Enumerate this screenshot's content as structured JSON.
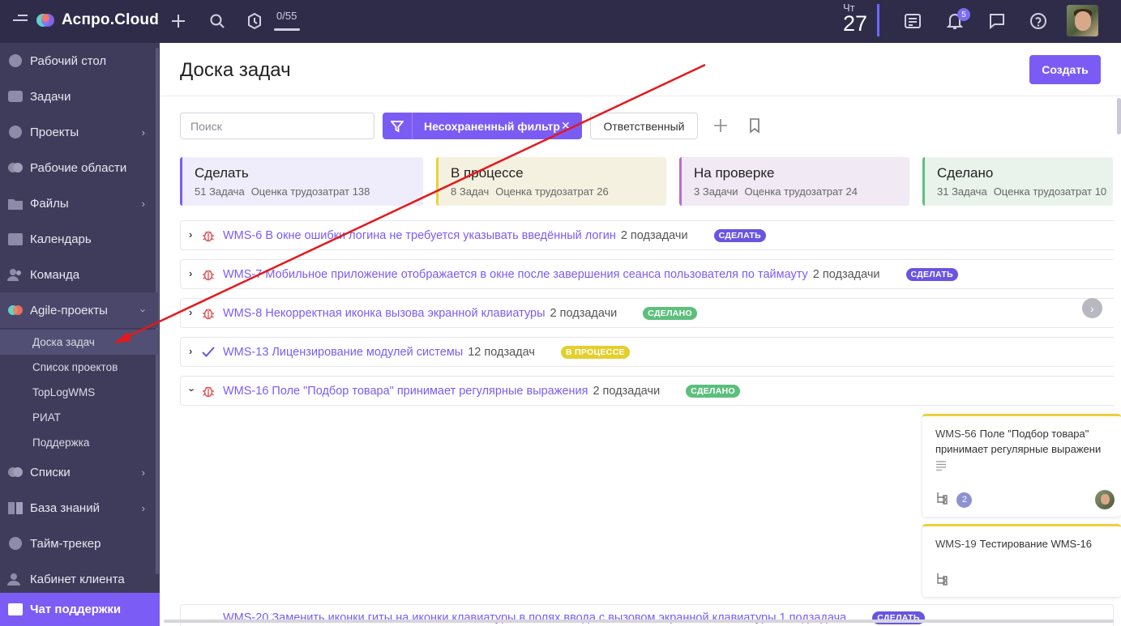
{
  "app": {
    "logo_text": "Аспро.Cloud",
    "progress_counter": "0/55",
    "progress_fraction": 0.0,
    "date_dow": "Чт",
    "date_day": "27",
    "notifications_count": "5",
    "colors": {
      "topbar": "#2f2c4a",
      "sidebar": "#3f3c5b",
      "accent": "#7a5cf4"
    }
  },
  "sidebar": {
    "items": [
      {
        "label": "Рабочий стол",
        "icon": "desktop-icon"
      },
      {
        "label": "Задачи",
        "icon": "tasks-icon"
      },
      {
        "label": "Проекты",
        "icon": "projects-icon"
      },
      {
        "label": "Рабочие области",
        "icon": "workspaces-icon"
      },
      {
        "label": "Файлы",
        "icon": "files-icon"
      },
      {
        "label": "Календарь",
        "icon": "calendar-icon"
      },
      {
        "label": "Команда",
        "icon": "team-icon"
      },
      {
        "label": "Agile-проекты",
        "icon": "agile-icon"
      },
      {
        "label": "Списки",
        "icon": "lists-icon"
      },
      {
        "label": "База знаний",
        "icon": "knowledge-icon"
      },
      {
        "label": "Тайм-трекер",
        "icon": "timetracker-icon"
      },
      {
        "label": "Кабинет клиента",
        "icon": "client-icon"
      }
    ],
    "agile_sub": [
      "Доска задач",
      "Список проектов",
      "TopLogWMS",
      "РИАТ",
      "Поддержка"
    ],
    "chat_support": "Чат поддержки"
  },
  "page": {
    "title": "Доска задач",
    "create_label": "Создать",
    "search_placeholder": "Поиск",
    "filter_label": "Несохраненный фильтр",
    "responsible_label": "Ответственный"
  },
  "columns": [
    {
      "title": "Сделать",
      "count": "51 Задача",
      "estimate": "Оценка трудозатрат 138",
      "color": "#7a5cf4",
      "bg": "#efedfb"
    },
    {
      "title": "В процессе",
      "count": "8 Задач",
      "estimate": "Оценка трудозатрат 26",
      "color": "#e8d23b",
      "bg": "#f5f1e0"
    },
    {
      "title": "На проверке",
      "count": "3 Задачи",
      "estimate": "Оценка трудозатрат 24",
      "color": "#b76bd1",
      "bg": "#f1e9f3"
    },
    {
      "title": "Сделано",
      "count": "31 Задача",
      "estimate": "Оценка трудозатрат 10",
      "color": "#5cc27a",
      "bg": "#e9f3ec"
    }
  ],
  "tasks": [
    {
      "title": "WMS-6 В окне ошибки логина не требуется указывать введённый логин",
      "subtasks": "2 подзадачи",
      "status": "СДЕЛАТЬ",
      "status_color": "#6a55e0",
      "icon": "bug-icon",
      "expanded": false
    },
    {
      "title": "WMS-7 Мобильное приложение отображается в окне после завершения сеанса пользователя по таймауту",
      "subtasks": "2 подзадачи",
      "status": "СДЕЛАТЬ",
      "status_color": "#6a55e0",
      "icon": "bug-icon",
      "expanded": false
    },
    {
      "title": "WMS-8 Некорректная иконка вызова экранной клавиатуры",
      "subtasks": "2 подзадачи",
      "status": "СДЕЛАНО",
      "status_color": "#5cbf7c",
      "icon": "bug-icon",
      "expanded": false
    },
    {
      "title": "WMS-13 Лицензирование модулей системы",
      "subtasks": "12 подзадач",
      "status": "В ПРОЦЕССЕ",
      "status_color": "#e4cf2c",
      "icon": "check-icon",
      "expanded": false
    },
    {
      "title": "WMS-16 Поле \"Подбор товара\" принимает регулярные выражения",
      "subtasks": "2 подзадачи",
      "status": "СДЕЛАНО",
      "status_color": "#5cbf7c",
      "icon": "bug-icon",
      "expanded": true
    }
  ],
  "subcards": [
    {
      "id": "WMS-56",
      "text": "Поле \"Подбор товара\" принимает регулярные выражени",
      "count": "2"
    },
    {
      "id": "WMS-19",
      "text": "Тестирование WMS-16"
    }
  ],
  "bottom_task": {
    "title": "WMS-20 Заменить иконки гиты на иконки клавиатуры в полях ввода с вызовом экранной клавиатуры 1 подзадача",
    "status": "СДЕЛАТЬ"
  }
}
